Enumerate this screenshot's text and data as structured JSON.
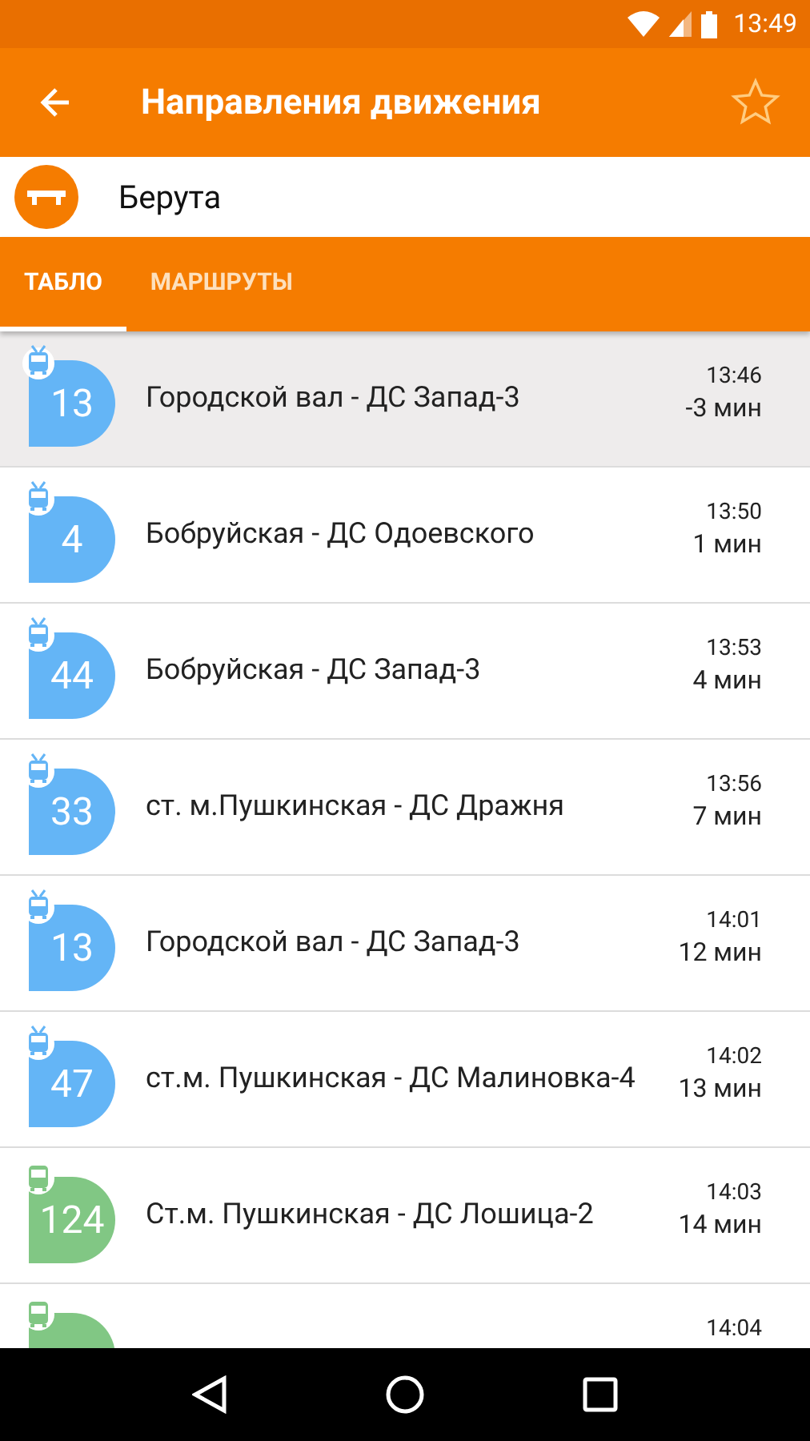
{
  "status_bar": {
    "time": "13:49"
  },
  "app_bar": {
    "title": "Направления движения",
    "favorite": false
  },
  "stop": {
    "name": "Берута"
  },
  "tabs": [
    {
      "label": "ТАБЛО",
      "selected": true
    },
    {
      "label": "МАРШРУТЫ",
      "selected": false
    }
  ],
  "departures": [
    {
      "kind": "trolleybus",
      "color": "#64b5f6",
      "number": "13",
      "route": "Городской вал - ДС Запад-3",
      "time": "13:46",
      "wait": "-3 мин",
      "selected": true
    },
    {
      "kind": "trolleybus",
      "color": "#64b5f6",
      "number": "4",
      "route": "Бобруйская - ДС Одоевского",
      "time": "13:50",
      "wait": "1 мин",
      "selected": false
    },
    {
      "kind": "trolleybus",
      "color": "#64b5f6",
      "number": "44",
      "route": "Бобруйская - ДС Запад-3",
      "time": "13:53",
      "wait": "4 мин",
      "selected": false
    },
    {
      "kind": "trolleybus",
      "color": "#64b5f6",
      "number": "33",
      "route": "ст. м.Пушкинская - ДС Дражня",
      "time": "13:56",
      "wait": "7 мин",
      "selected": false
    },
    {
      "kind": "trolleybus",
      "color": "#64b5f6",
      "number": "13",
      "route": "Городской вал - ДС Запад-3",
      "time": "14:01",
      "wait": "12 мин",
      "selected": false
    },
    {
      "kind": "trolleybus",
      "color": "#64b5f6",
      "number": "47",
      "route": "ст.м. Пушкинская - ДС Малиновка-4",
      "time": "14:02",
      "wait": "13 мин",
      "selected": false
    },
    {
      "kind": "bus",
      "color": "#81c784",
      "number": "124",
      "route": "Ст.м. Пушкинская - ДС Лошица-2",
      "time": "14:03",
      "wait": "14 мин",
      "selected": false
    },
    {
      "kind": "bus",
      "color": "#81c784",
      "time": "14:04",
      "selected": false
    }
  ]
}
